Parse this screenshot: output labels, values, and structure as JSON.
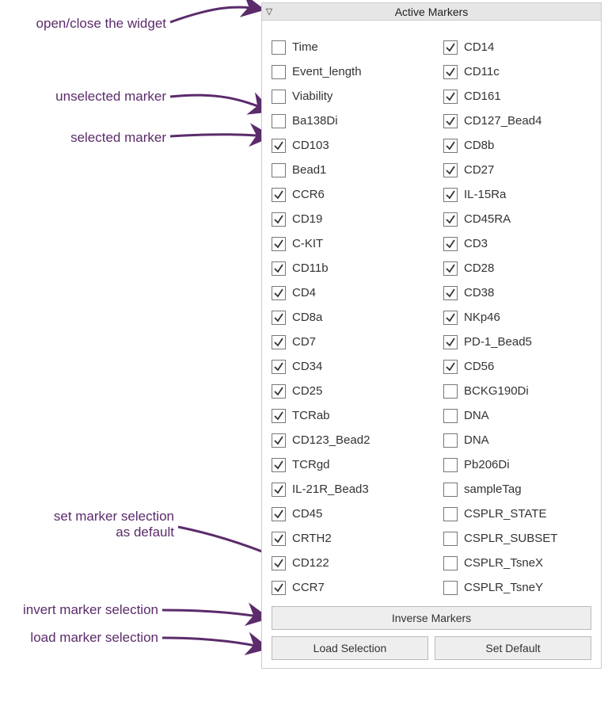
{
  "widget": {
    "title": "Active Markers",
    "toggle_glyph": "▽"
  },
  "annotations": {
    "open_close": "open/close the widget",
    "unselected": "unselected marker",
    "selected": "selected marker",
    "set_default_l1": "set marker selection",
    "set_default_l2": "as default",
    "invert": "invert marker selection",
    "load": "load marker selection"
  },
  "buttons": {
    "inverse": "Inverse Markers",
    "load": "Load Selection",
    "set_default": "Set Default"
  },
  "markers": {
    "left": [
      {
        "label": "Time",
        "checked": false
      },
      {
        "label": "Event_length",
        "checked": false
      },
      {
        "label": "Viability",
        "checked": false
      },
      {
        "label": "Ba138Di",
        "checked": false
      },
      {
        "label": "CD103",
        "checked": true
      },
      {
        "label": "Bead1",
        "checked": false
      },
      {
        "label": "CCR6",
        "checked": true
      },
      {
        "label": "CD19",
        "checked": true
      },
      {
        "label": "C-KIT",
        "checked": true
      },
      {
        "label": "CD11b",
        "checked": true
      },
      {
        "label": "CD4",
        "checked": true
      },
      {
        "label": "CD8a",
        "checked": true
      },
      {
        "label": "CD7",
        "checked": true
      },
      {
        "label": "CD34",
        "checked": true
      },
      {
        "label": "CD25",
        "checked": true
      },
      {
        "label": "TCRab",
        "checked": true
      },
      {
        "label": "CD123_Bead2",
        "checked": true
      },
      {
        "label": "TCRgd",
        "checked": true
      },
      {
        "label": "IL-21R_Bead3",
        "checked": true
      },
      {
        "label": "CD45",
        "checked": true
      },
      {
        "label": "CRTH2",
        "checked": true
      },
      {
        "label": "CD122",
        "checked": true
      },
      {
        "label": "CCR7",
        "checked": true
      }
    ],
    "right": [
      {
        "label": "CD14",
        "checked": true
      },
      {
        "label": "CD11c",
        "checked": true
      },
      {
        "label": "CD161",
        "checked": true
      },
      {
        "label": "CD127_Bead4",
        "checked": true
      },
      {
        "label": "CD8b",
        "checked": true
      },
      {
        "label": "CD27",
        "checked": true
      },
      {
        "label": "IL-15Ra",
        "checked": true
      },
      {
        "label": "CD45RA",
        "checked": true
      },
      {
        "label": "CD3",
        "checked": true
      },
      {
        "label": "CD28",
        "checked": true
      },
      {
        "label": "CD38",
        "checked": true
      },
      {
        "label": "NKp46",
        "checked": true
      },
      {
        "label": "PD-1_Bead5",
        "checked": true
      },
      {
        "label": "CD56",
        "checked": true
      },
      {
        "label": "BCKG190Di",
        "checked": false
      },
      {
        "label": "DNA",
        "checked": false
      },
      {
        "label": "DNA",
        "checked": false
      },
      {
        "label": "Pb206Di",
        "checked": false
      },
      {
        "label": "sampleTag",
        "checked": false
      },
      {
        "label": "CSPLR_STATE",
        "checked": false
      },
      {
        "label": "CSPLR_SUBSET",
        "checked": false
      },
      {
        "label": "CSPLR_TsneX",
        "checked": false
      },
      {
        "label": "CSPLR_TsneY",
        "checked": false
      }
    ]
  }
}
